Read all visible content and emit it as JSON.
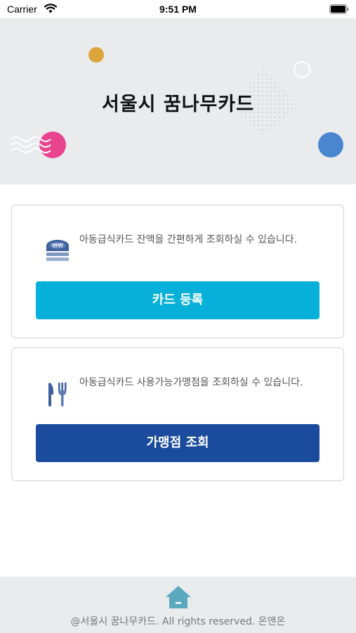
{
  "status_bar": {
    "carrier": "Carrier",
    "time": "9:51 PM"
  },
  "hero": {
    "title": "서울시 꿈나무카드"
  },
  "cards": [
    {
      "icon": "card-stack-icon",
      "description": "아동급식카드 잔액을 간편하게 조회하실 수 있습니다.",
      "button_label": "카드 등록",
      "button_color": "#06b0d8"
    },
    {
      "icon": "fork-knife-icon",
      "description": "아동급식카드 사용가능가맹점을 조회하실 수 있습니다.",
      "button_label": "가맹점 조회",
      "button_color": "#1a4b9c"
    }
  ],
  "footer": {
    "icon": "home-icon",
    "copyright": "@서울시 꿈나무카드. All rights reserved. 온앤온"
  },
  "colors": {
    "hero_bg": "#eaebed",
    "accent_cyan": "#06b0d8",
    "accent_navy": "#1a4b9c"
  }
}
